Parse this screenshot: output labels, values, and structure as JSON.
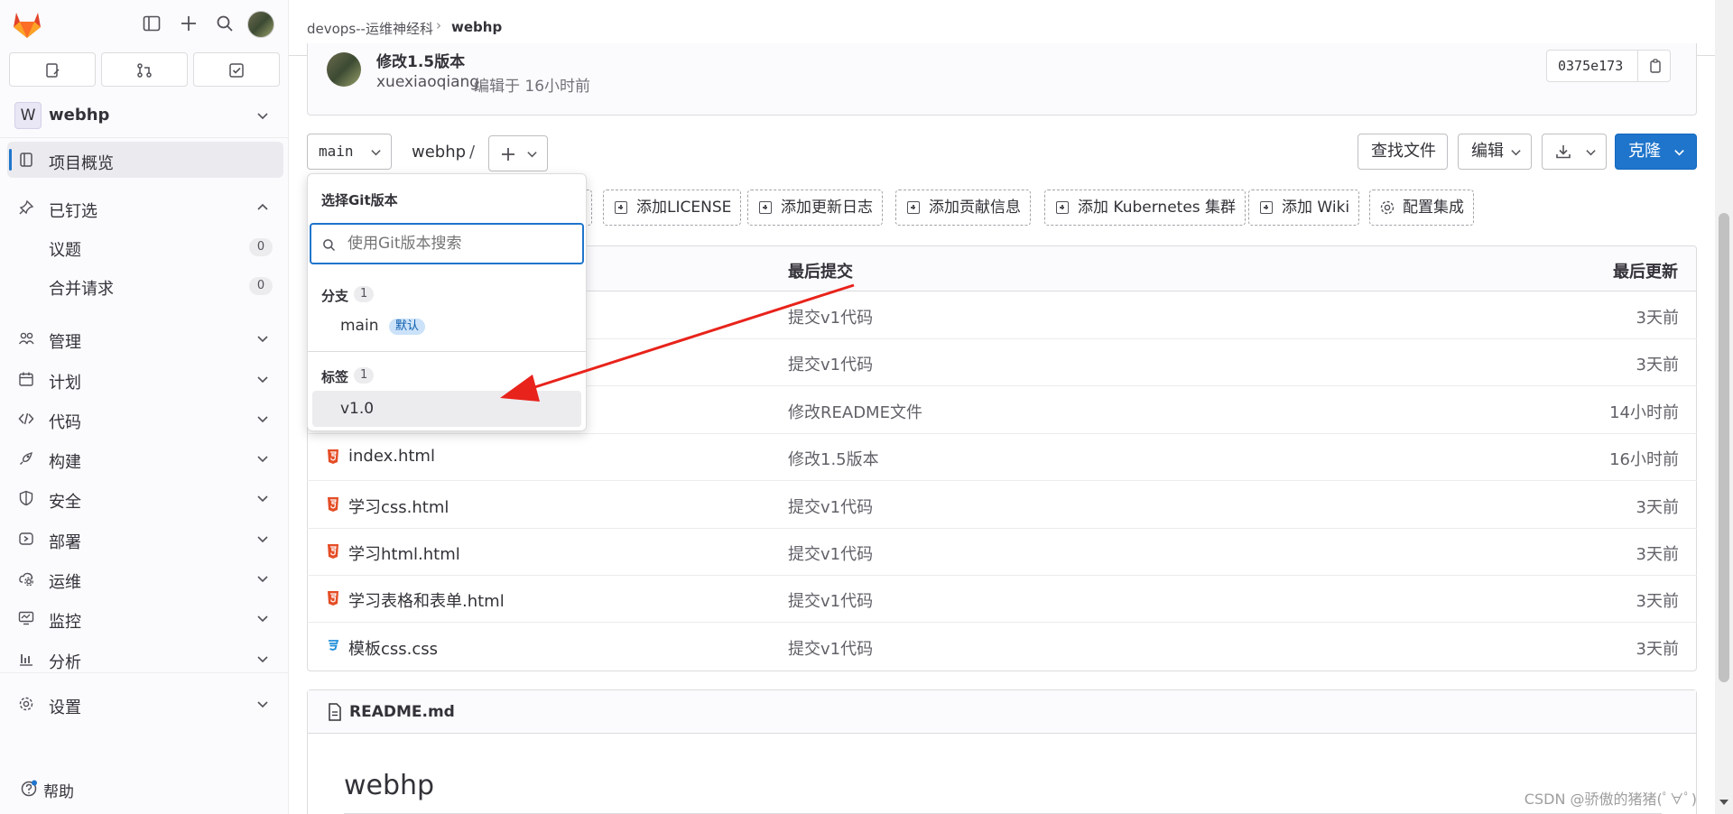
{
  "sidebar": {
    "project_avatar_letter": "W",
    "project_name": "webhp",
    "overview_label": "项目概览",
    "pinned_label": "已钉选",
    "pinned_items": [
      {
        "label": "议题",
        "count": "0"
      },
      {
        "label": "合并请求",
        "count": "0"
      }
    ],
    "nav_items": [
      {
        "label": "管理",
        "icon": "users-icon"
      },
      {
        "label": "计划",
        "icon": "calendar-icon"
      },
      {
        "label": "代码",
        "icon": "code-icon"
      },
      {
        "label": "构建",
        "icon": "rocket-icon"
      },
      {
        "label": "安全",
        "icon": "shield-icon"
      },
      {
        "label": "部署",
        "icon": "deploy-icon"
      },
      {
        "label": "运维",
        "icon": "cloud-gear-icon"
      },
      {
        "label": "监控",
        "icon": "monitor-icon"
      },
      {
        "label": "分析",
        "icon": "chart-icon"
      },
      {
        "label": "设置",
        "icon": "gear-icon"
      }
    ],
    "help_label": "帮助"
  },
  "breadcrumb": {
    "group": "devops--运维神经科",
    "project": "webhp"
  },
  "last_commit": {
    "title": "修改1.5版本",
    "author": "xuexiaoqiang",
    "meta": "编辑于 16小时前",
    "sha": "0375e173"
  },
  "toolbar": {
    "branch": "main",
    "path": "webhp",
    "path_sep": "/",
    "find_file": "查找文件",
    "edit": "编辑",
    "clone": "克隆"
  },
  "quick_actions": [
    "添加LICENSE",
    "添加更新日志",
    "添加贡献信息",
    "添加 Kubernetes 集群",
    "添加 Wiki"
  ],
  "config_integration": "配置集成",
  "table": {
    "col_commit": "最后提交",
    "col_updated": "最后更新",
    "rows": [
      {
        "name": "",
        "commit": "提交v1代码",
        "updated": "3天前",
        "type": "hidden"
      },
      {
        "name": "",
        "commit": "提交v1代码",
        "updated": "3天前",
        "type": "hidden"
      },
      {
        "name": "",
        "commit": "修改README文件",
        "updated": "14小时前",
        "type": "hidden"
      },
      {
        "name": "index.html",
        "commit": "修改1.5版本",
        "updated": "16小时前",
        "type": "html"
      },
      {
        "name": "学习css.html",
        "commit": "提交v1代码",
        "updated": "3天前",
        "type": "html"
      },
      {
        "name": "学习html.html",
        "commit": "提交v1代码",
        "updated": "3天前",
        "type": "html"
      },
      {
        "name": "学习表格和表单.html",
        "commit": "提交v1代码",
        "updated": "3天前",
        "type": "html"
      },
      {
        "name": "模板css.css",
        "commit": "提交v1代码",
        "updated": "3天前",
        "type": "css"
      }
    ]
  },
  "readme": {
    "filename": "README.md",
    "heading": "webhp"
  },
  "dropdown": {
    "title": "选择Git版本",
    "search_placeholder": "使用Git版本搜索",
    "branches_label": "分支",
    "branches_count": "1",
    "branch_item": "main",
    "default_badge": "默认",
    "tags_label": "标签",
    "tags_count": "1",
    "tag_item": "v1.0"
  },
  "watermark": "CSDN @骄傲的猪猪(ﾟ∀ﾟ)",
  "colors": {
    "accent": "#1f75cb",
    "annotation_arrow": "#e8231b",
    "sidebar_bg": "#fbfafd"
  }
}
